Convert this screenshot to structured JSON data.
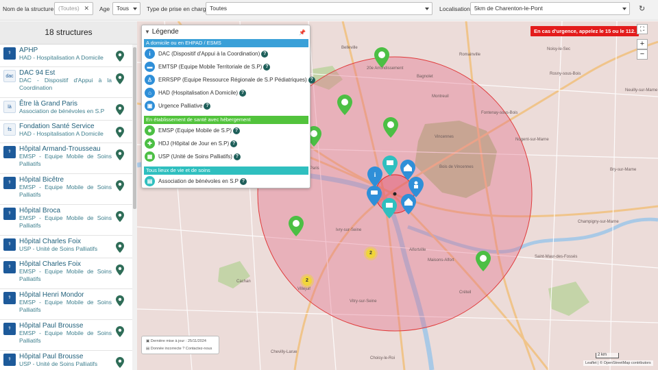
{
  "filters": {
    "name_label": "Nom de la structure",
    "name_placeholder": "(Toutes)",
    "age_label": "Age",
    "age_value": "Tous",
    "type_label": "Type de prise en charge",
    "type_value": "Toutes",
    "location_label": "Localisation",
    "location_value": "5km de Charenton-le-Pont"
  },
  "sidebar": {
    "count_title": "18 structures",
    "items": [
      {
        "name": "APHP",
        "desc": "HAD - Hospitalisation A Domicile"
      },
      {
        "name": "DAC 94 Est",
        "desc": "DAC - Dispositif d'Appui à la Coordination"
      },
      {
        "name": "Être là Grand Paris",
        "desc": "Association de bénévoles en S.P"
      },
      {
        "name": "Fondation Santé Service",
        "desc": "HAD - Hospitalisation A Domicile"
      },
      {
        "name": "Hôpital Armand-Trousseau",
        "desc": "EMSP - Equipe Mobile de Soins Palliatifs"
      },
      {
        "name": "Hôpital Bicêtre",
        "desc": "EMSP - Equipe Mobile de Soins Palliatifs"
      },
      {
        "name": "Hôpital Broca",
        "desc": "EMSP - Equipe Mobile de Soins Palliatifs"
      },
      {
        "name": "Hôpital Charles Foix",
        "desc": "USP - Unité de Soins Palliatifs"
      },
      {
        "name": "Hôpital Charles Foix",
        "desc": "EMSP - Equipe Mobile de Soins Palliatifs"
      },
      {
        "name": "Hôpital Henri Mondor",
        "desc": "EMSP - Equipe Mobile de Soins Palliatifs"
      },
      {
        "name": "Hôpital Paul Brousse",
        "desc": "EMSP - Equipe Mobile de Soins Palliatifs"
      },
      {
        "name": "Hôpital Paul Brousse",
        "desc": "USP - Unité de Soins Palliatifs"
      }
    ]
  },
  "map": {
    "emergency_banner": "En cas d'urgence, appelez le 15 ou le 112.",
    "zoom_in": "+",
    "zoom_out": "−",
    "attribution": "Leaflet | © OpenStreetMap contributors",
    "scale": "2 km",
    "last_update": "Dernière mise à jour : 25/11/2024",
    "report": "Donnée incorrecte ? Contactez-nous",
    "clusters": [
      {
        "count": "2"
      },
      {
        "count": "2"
      }
    ],
    "places": [
      "Belleville",
      "20e Arrondissement",
      "Romainville",
      "Montreuil",
      "Bagnolet",
      "Paris",
      "Vincennes",
      "Fontenay-sous-Bois",
      "Bois de Vincennes",
      "Nogent-sur-Marne",
      "Ivry-sur-Seine",
      "Vitry-sur-Seine",
      "Alfortville",
      "Maisons-Alfort",
      "Créteil",
      "Saint-Maur-des-Fossés",
      "Champigny-sur-Marne",
      "Villejuif",
      "Cachan",
      "Chevilly-Larue",
      "Choisy-le-Roi",
      "Noisy-le-Sec",
      "Rosny-sous-Bois",
      "Neuilly-sur-Marne",
      "Bry-sur-Marne"
    ]
  },
  "legend": {
    "title": "Légende",
    "sections": [
      {
        "title": "A domicile ou en EHPAD / ESMS",
        "color": "#3aa0d8",
        "rows": [
          "DAC (Dispositif d'Appui à la Coordination)",
          "EMTSP (Equipe Mobile Territoriale de S.P)",
          "ERRSPP (Equipe Ressource Régionale de S.P Pédiatriques)",
          "HAD (Hospitalisation A Domicile)",
          "Urgence Palliative"
        ]
      },
      {
        "title": "En établissement de santé avec hébergement",
        "color": "#52c33c",
        "rows": [
          "EMSP (Equipe Mobile de S.P)",
          "HDJ (Hôpital de Jour en S.P)",
          "USP (Unité de Soins Palliatifs)"
        ]
      },
      {
        "title": "Tous lieux de vie et de soins",
        "color": "#2fbfbf",
        "rows": [
          "Association de bénévoles en S.P"
        ]
      }
    ],
    "help": "?"
  }
}
